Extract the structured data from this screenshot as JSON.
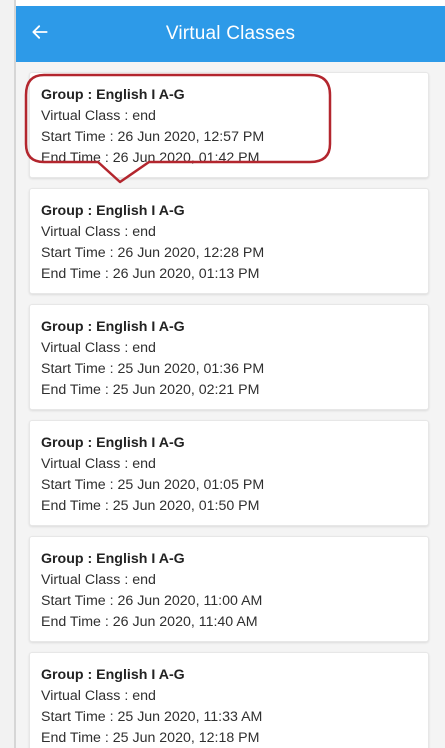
{
  "app_bar": {
    "title": "Virtual Classes",
    "back_icon": "arrow-left-icon",
    "color": "#2d9ae8"
  },
  "annotation": {
    "color": "#b3262e"
  },
  "classes": [
    {
      "group": "Group : English I A-G",
      "status": "Virtual Class : end",
      "start": "Start Time : 26 Jun 2020, 12:57 PM",
      "end": "End Time : 26 Jun 2020, 01:42 PM"
    },
    {
      "group": "Group : English I A-G",
      "status": "Virtual Class : end",
      "start": "Start Time : 26 Jun 2020, 12:28 PM",
      "end": "End Time : 26 Jun 2020, 01:13 PM"
    },
    {
      "group": "Group : English I A-G",
      "status": "Virtual Class : end",
      "start": "Start Time : 25 Jun 2020, 01:36 PM",
      "end": "End Time : 25 Jun 2020, 02:21 PM"
    },
    {
      "group": "Group : English I A-G",
      "status": "Virtual Class : end",
      "start": "Start Time : 25 Jun 2020, 01:05 PM",
      "end": "End Time : 25 Jun 2020, 01:50 PM"
    },
    {
      "group": "Group : English I A-G",
      "status": "Virtual Class : end",
      "start": "Start Time : 26 Jun 2020, 11:00 AM",
      "end": "End Time : 26 Jun 2020, 11:40 AM"
    },
    {
      "group": "Group : English I A-G",
      "status": "Virtual Class : end",
      "start": "Start Time : 25 Jun 2020, 11:33 AM",
      "end": "End Time : 25 Jun 2020, 12:18 PM"
    }
  ]
}
